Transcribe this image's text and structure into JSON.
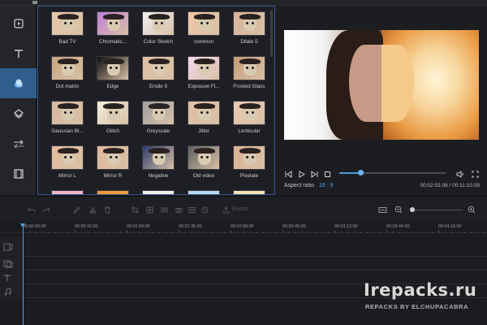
{
  "sidebar": {
    "items": [
      {
        "icon": "media-icon"
      },
      {
        "icon": "text-icon"
      },
      {
        "icon": "filters-icon",
        "active": true
      },
      {
        "icon": "overlays-icon"
      },
      {
        "icon": "transitions-icon"
      },
      {
        "icon": "film-icon"
      }
    ]
  },
  "filters": {
    "items": [
      {
        "label": "Bad TV",
        "tint": "#e9c7a9"
      },
      {
        "label": "Chromatic...",
        "tint": "#c080d8"
      },
      {
        "label": "Color Sketch",
        "tint": "#efeff3"
      },
      {
        "label": "common",
        "tint": "#f2c9a8"
      },
      {
        "label": "Dilate 5",
        "tint": "#d9b49a"
      },
      {
        "label": "Dot matrix",
        "tint": "#c8a37f"
      },
      {
        "label": "Edge",
        "tint": "#101010"
      },
      {
        "label": "Erode 5",
        "tint": "#e3c0a2"
      },
      {
        "label": "Exposure Fl...",
        "tint": "#f7d7ee"
      },
      {
        "label": "Frosted Glass",
        "tint": "#c59b77"
      },
      {
        "label": "Gaussian Bl...",
        "tint": "#d8b79f"
      },
      {
        "label": "Glitch",
        "tint": "#f4f0dc"
      },
      {
        "label": "Greyscale",
        "tint": "#a0a0a0"
      },
      {
        "label": "Jitter",
        "tint": "#e1bfa3"
      },
      {
        "label": "Lenticular",
        "tint": "#ecc9b0"
      },
      {
        "label": "Mirror L",
        "tint": "#e3bb9c"
      },
      {
        "label": "Mirror R",
        "tint": "#e0b899"
      },
      {
        "label": "Negative",
        "tint": "#2d3a6c"
      },
      {
        "label": "Old video",
        "tint": "#5f5f5f"
      },
      {
        "label": "Pixelate",
        "tint": "#dcb291"
      }
    ],
    "partial_row_tints": [
      "#f0b4c8",
      "#f29a3c",
      "#efefef",
      "#b8d7f0",
      "#f3e2b8"
    ]
  },
  "player": {
    "aspect_label": "Aspect ratio",
    "aspect_value": "16 : 9",
    "time": "00:02:02.06 / 00:11:10.09",
    "progress": 0.2
  },
  "toolbar": {
    "export_label": "Export",
    "zoom_level": 0.05
  },
  "timeline": {
    "ticks": [
      "00:00:00.00",
      "00:00:32.00",
      "00:01:04.00",
      "00:01:36.00",
      "00:02:08.00",
      "00:02:40.00",
      "00:03:12.00",
      "00:03:44.00",
      "00:04:16.00"
    ]
  },
  "watermark": {
    "site": "Irepacks.ru",
    "credit": "REPACKS BY ELCHUPACABRA"
  },
  "colors": {
    "accent": "#4aa3ee",
    "active_tab": "#2f5d8c",
    "panel": "#1e1f24"
  }
}
